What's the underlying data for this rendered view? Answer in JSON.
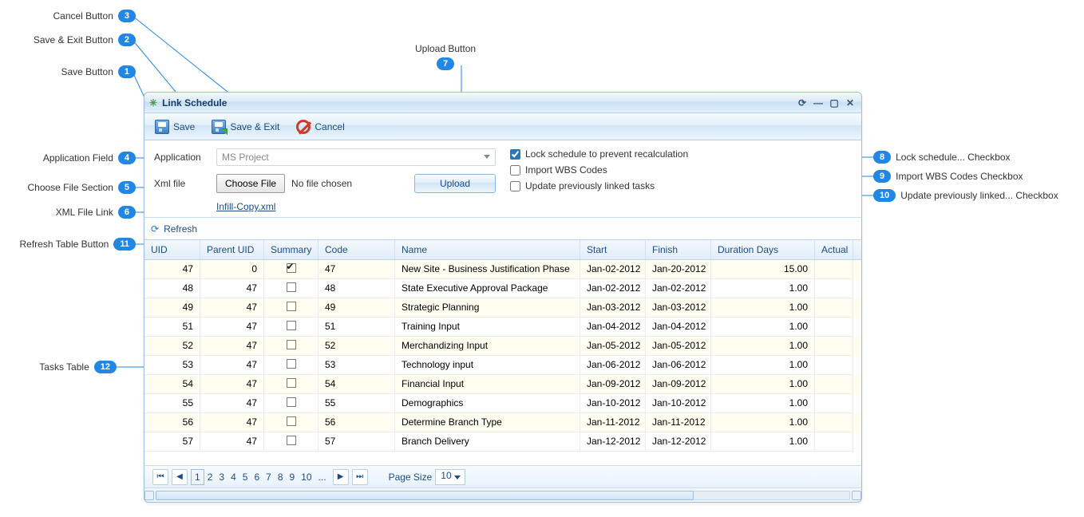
{
  "window": {
    "title": "Link Schedule"
  },
  "toolbar": {
    "save": "Save",
    "save_exit": "Save & Exit",
    "cancel": "Cancel"
  },
  "form": {
    "application_label": "Application",
    "application_value": "MS Project",
    "xml_label": "Xml file",
    "choose_file_btn": "Choose File",
    "file_status": "No file chosen",
    "xml_link": "Infill-Copy.xml",
    "upload_btn": "Upload",
    "lock_label": "Lock schedule to prevent recalculation",
    "lock_checked": true,
    "import_wbs_label": "Import WBS Codes",
    "import_wbs_checked": false,
    "update_prev_label": "Update previously linked tasks",
    "update_prev_checked": false
  },
  "refresh": {
    "label": "Refresh"
  },
  "grid": {
    "columns": [
      "UID",
      "Parent UID",
      "Summary",
      "Code",
      "Name",
      "Start",
      "Finish",
      "Duration Days",
      "Actual"
    ],
    "rows": [
      {
        "uid": 47,
        "parent": 0,
        "summary": true,
        "code": "47",
        "name": "New Site - Business Justification Phase",
        "start": "Jan-02-2012",
        "finish": "Jan-20-2012",
        "duration": "15.00",
        "actual": ""
      },
      {
        "uid": 48,
        "parent": 47,
        "summary": false,
        "code": "48",
        "name": "State Executive Approval Package",
        "start": "Jan-02-2012",
        "finish": "Jan-02-2012",
        "duration": "1.00",
        "actual": ""
      },
      {
        "uid": 49,
        "parent": 47,
        "summary": false,
        "code": "49",
        "name": "Strategic Planning",
        "start": "Jan-03-2012",
        "finish": "Jan-03-2012",
        "duration": "1.00",
        "actual": ""
      },
      {
        "uid": 51,
        "parent": 47,
        "summary": false,
        "code": "51",
        "name": "Training Input",
        "start": "Jan-04-2012",
        "finish": "Jan-04-2012",
        "duration": "1.00",
        "actual": ""
      },
      {
        "uid": 52,
        "parent": 47,
        "summary": false,
        "code": "52",
        "name": "Merchandizing Input",
        "start": "Jan-05-2012",
        "finish": "Jan-05-2012",
        "duration": "1.00",
        "actual": ""
      },
      {
        "uid": 53,
        "parent": 47,
        "summary": false,
        "code": "53",
        "name": "Technology input",
        "start": "Jan-06-2012",
        "finish": "Jan-06-2012",
        "duration": "1.00",
        "actual": ""
      },
      {
        "uid": 54,
        "parent": 47,
        "summary": false,
        "code": "54",
        "name": "Financial Input",
        "start": "Jan-09-2012",
        "finish": "Jan-09-2012",
        "duration": "1.00",
        "actual": ""
      },
      {
        "uid": 55,
        "parent": 47,
        "summary": false,
        "code": "55",
        "name": "Demographics",
        "start": "Jan-10-2012",
        "finish": "Jan-10-2012",
        "duration": "1.00",
        "actual": ""
      },
      {
        "uid": 56,
        "parent": 47,
        "summary": false,
        "code": "56",
        "name": "Determine Branch Type",
        "start": "Jan-11-2012",
        "finish": "Jan-11-2012",
        "duration": "1.00",
        "actual": ""
      },
      {
        "uid": 57,
        "parent": 47,
        "summary": false,
        "code": "57",
        "name": "Branch Delivery",
        "start": "Jan-12-2012",
        "finish": "Jan-12-2012",
        "duration": "1.00",
        "actual": ""
      }
    ]
  },
  "pager": {
    "pages_visible": [
      "1",
      "2",
      "3",
      "4",
      "5",
      "6",
      "7",
      "8",
      "9",
      "10",
      "..."
    ],
    "current": "1",
    "page_size_label": "Page Size",
    "page_size_value": "10"
  },
  "annotations": {
    "1": "Save Button",
    "2": "Save & Exit Button",
    "3": "Cancel Button",
    "4": "Application Field",
    "5": "Choose File Section",
    "6": "XML File Link",
    "7": "Upload Button",
    "8": "Lock schedule... Checkbox",
    "9": "Import WBS Codes Checkbox",
    "10": "Update previously linked... Checkbox",
    "11": "Refresh Table Button",
    "12": "Tasks Table"
  }
}
